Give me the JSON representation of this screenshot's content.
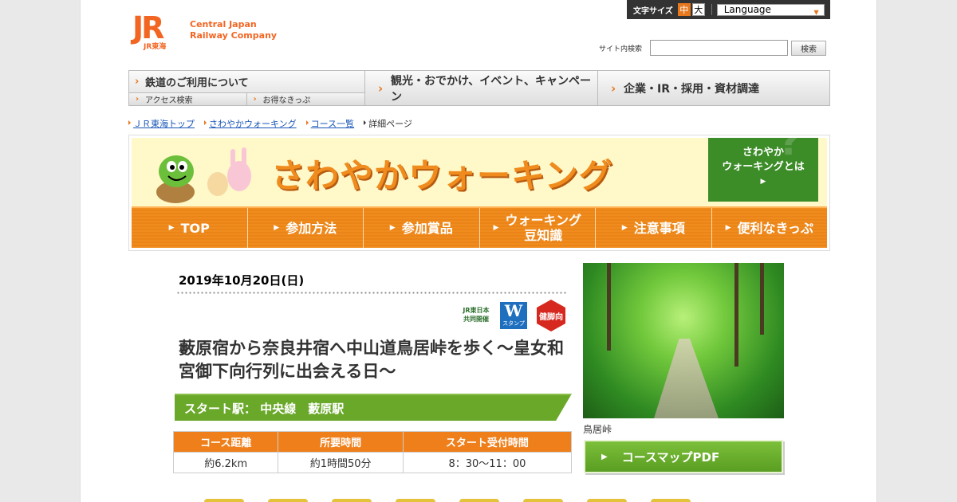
{
  "util": {
    "font_size_label": "文字サイズ",
    "font_mid": "中",
    "font_big": "大",
    "language": "Language"
  },
  "logo": {
    "mark": "JR",
    "sub": "JR東海",
    "line1": "Central Japan",
    "line2": "Railway Company"
  },
  "search": {
    "label": "サイト内検索",
    "value": "",
    "button": "検索"
  },
  "gnav": {
    "rail": "鉄道のご利用について",
    "access": "アクセス検索",
    "tickets": "お得なきっぷ",
    "tourism": "観光・おでかけ、イベント、キャンペーン",
    "corporate": "企業・IR・採用・資材調達"
  },
  "breadcrumb": [
    {
      "label": "ＪＲ東海トップ"
    },
    {
      "label": "さわやかウォーキング"
    },
    {
      "label": "コース一覧"
    },
    {
      "label": "詳細ページ"
    }
  ],
  "banner": {
    "title": "さわやかウォーキング",
    "about_line1": "さわやか",
    "about_line2": "ウォーキングとは",
    "tabs": [
      {
        "label": "TOP"
      },
      {
        "label": "参加方法"
      },
      {
        "label": "参加賞品"
      },
      {
        "line1": "ウォーキング",
        "line2": "豆知識"
      },
      {
        "label": "注意事項"
      },
      {
        "label": "便利なきっぷ"
      }
    ]
  },
  "detail": {
    "date": "2019年10月20日(日)",
    "badge_jr_line1": "JR東日本",
    "badge_jr_line2": "共同開催",
    "badge_w": "W",
    "badge_w_sub": "スタンプ",
    "badge_k": "健脚向",
    "title": "藪原宿から奈良井宿へ中山道鳥居峠を歩く～皇女和宮御下向行列に出会える日～",
    "start": "スタート駅：  中央線　藪原駅",
    "table": {
      "headers": [
        "コース距離",
        "所要時間",
        "スタート受付時間"
      ],
      "values": [
        "約6.2km",
        "約1時間50分",
        "8：30～11：00"
      ]
    },
    "photo_caption": "鳥居峠",
    "pdf_button": "コースマップPDF"
  }
}
